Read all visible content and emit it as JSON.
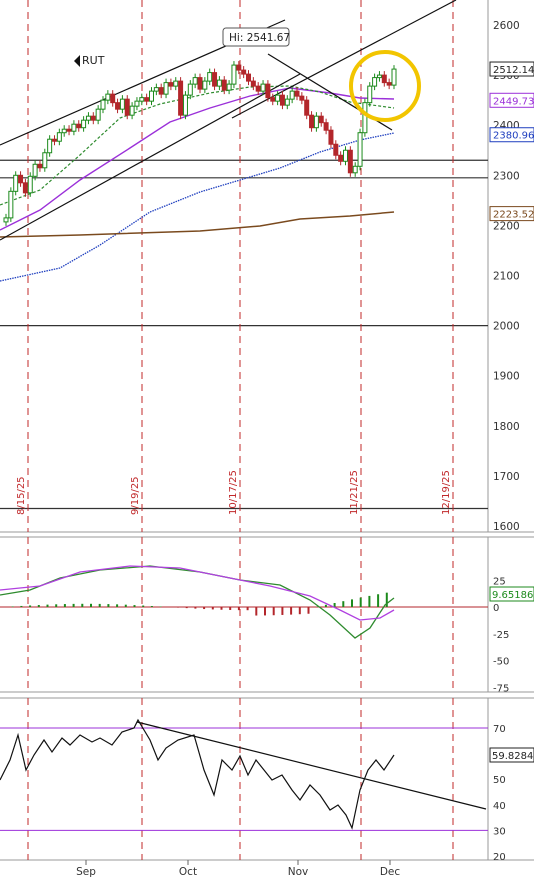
{
  "chart_data": [
    {
      "type": "candlestick",
      "symbol_label": "RUT",
      "hi_label": "Hi: 2541.67",
      "ylim": [
        1590,
        2655
      ],
      "y_ticks": [
        1600,
        1700,
        1800,
        1900,
        2000,
        2100,
        2200,
        2300,
        2400,
        2500,
        2600
      ],
      "price_tags": [
        {
          "value": 2512.14,
          "label": "2512.14",
          "color": "#222222"
        },
        {
          "value": 2449.73,
          "label": "2449.73",
          "color": "#9b30d9"
        },
        {
          "value": 2380.96,
          "label": "2380.96",
          "color": "#1f3fbf"
        },
        {
          "value": 2223.52,
          "label": "2223.52",
          "color": "#7a4a1e"
        }
      ],
      "date_markers": [
        "8/15/25",
        "9/19/25",
        "10/17/25",
        "11/21/25",
        "12/19/25"
      ],
      "horizontal_levels": [
        2330,
        2295,
        2000,
        1635
      ],
      "closes": [
        2215,
        2268,
        2300,
        2285,
        2265,
        2298,
        2322,
        2315,
        2345,
        2372,
        2368,
        2385,
        2392,
        2388,
        2402,
        2395,
        2410,
        2418,
        2410,
        2432,
        2450,
        2462,
        2445,
        2432,
        2452,
        2420,
        2438,
        2448,
        2455,
        2448,
        2468,
        2475,
        2462,
        2485,
        2478,
        2488,
        2420,
        2460,
        2482,
        2495,
        2472,
        2488,
        2505,
        2478,
        2490,
        2470,
        2482,
        2520,
        2510,
        2502,
        2488,
        2478,
        2468,
        2482,
        2455,
        2448,
        2460,
        2440,
        2452,
        2468,
        2458,
        2450,
        2420,
        2395,
        2418,
        2405,
        2390,
        2362,
        2340,
        2328,
        2350,
        2305,
        2318,
        2385,
        2445,
        2478,
        2495,
        2500,
        2485,
        2480,
        2512
      ]
    },
    {
      "type": "line",
      "ylim": [
        -80,
        40
      ],
      "y_ticks": [
        25,
        0,
        -25,
        -50,
        -75
      ],
      "value_tag": "9.65186"
    },
    {
      "type": "line",
      "ylim": [
        20,
        82
      ],
      "y_ticks": [
        70,
        60,
        50,
        40,
        30,
        20
      ],
      "levels": [
        70,
        30
      ],
      "value_tag": "59.8284",
      "x_labels": [
        "Sep",
        "Oct",
        "Nov",
        "Dec"
      ]
    }
  ]
}
